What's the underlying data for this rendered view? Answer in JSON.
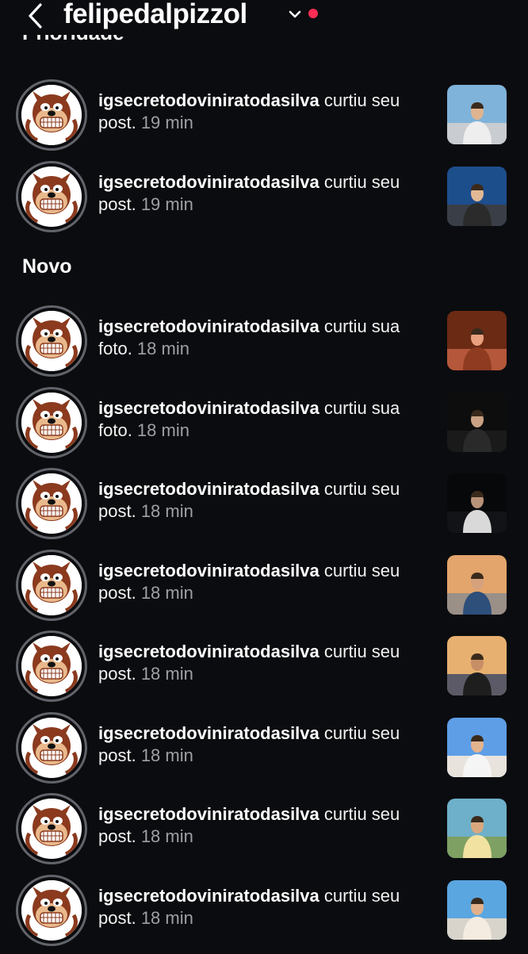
{
  "header": {
    "username": "felipedalpizzol"
  },
  "sections": {
    "priority_title": "Prioridade",
    "new_title": "Novo"
  },
  "notifications": [
    {
      "user": "igsecretodoviniratodasilva",
      "action": " curtiu seu post.",
      "time": " 19 min",
      "thumb": "thumb-1"
    },
    {
      "user": "igsecretodoviniratodasilva",
      "action": " curtiu seu post.",
      "time": " 19 min",
      "thumb": "thumb-2"
    },
    {
      "user": "igsecretodoviniratodasilva",
      "action": " curtiu sua foto.",
      "time": " 18 min",
      "thumb": "thumb-3"
    },
    {
      "user": "igsecretodoviniratodasilva",
      "action": " curtiu sua foto.",
      "time": " 18 min",
      "thumb": "thumb-4"
    },
    {
      "user": "igsecretodoviniratodasilva",
      "action": " curtiu seu post.",
      "time": " 18 min",
      "thumb": "thumb-5"
    },
    {
      "user": "igsecretodoviniratodasilva",
      "action": " curtiu seu post.",
      "time": " 18 min",
      "thumb": "thumb-6"
    },
    {
      "user": "igsecretodoviniratodasilva",
      "action": " curtiu seu post.",
      "time": " 18 min",
      "thumb": "thumb-7"
    },
    {
      "user": "igsecretodoviniratodasilva",
      "action": " curtiu seu post.",
      "time": " 18 min",
      "thumb": "thumb-8"
    },
    {
      "user": "igsecretodoviniratodasilva",
      "action": " curtiu seu post.",
      "time": " 18 min",
      "thumb": "thumb-9"
    },
    {
      "user": "igsecretodoviniratodasilva",
      "action": " curtiu seu post.",
      "time": " 18 min",
      "thumb": "thumb-10"
    }
  ],
  "icons": {
    "back": "chevron-left-icon",
    "account_switch": "chevron-down-icon",
    "unread": "notification-dot-icon"
  },
  "colors": {
    "background": "#0b0c0f",
    "text": "#f2f2f2",
    "muted": "#9ea0a6",
    "ring": "#62646b",
    "dot": "#ff2d55"
  }
}
